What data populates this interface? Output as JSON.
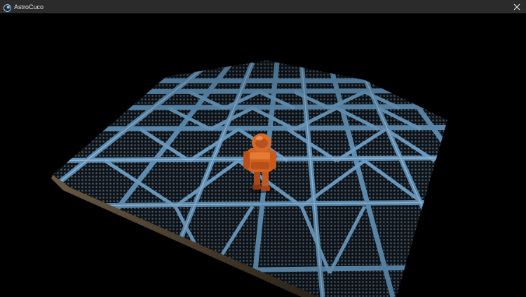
{
  "window": {
    "title": "AstroCuco",
    "app_icon": "astrocuco-app-icon",
    "close_icon": "close-icon"
  },
  "scene": {
    "background_color": "#000000",
    "floor_color": "#5f8fb4",
    "floor_mesh_color": "#0e141a",
    "character_color": "#d2601f"
  }
}
